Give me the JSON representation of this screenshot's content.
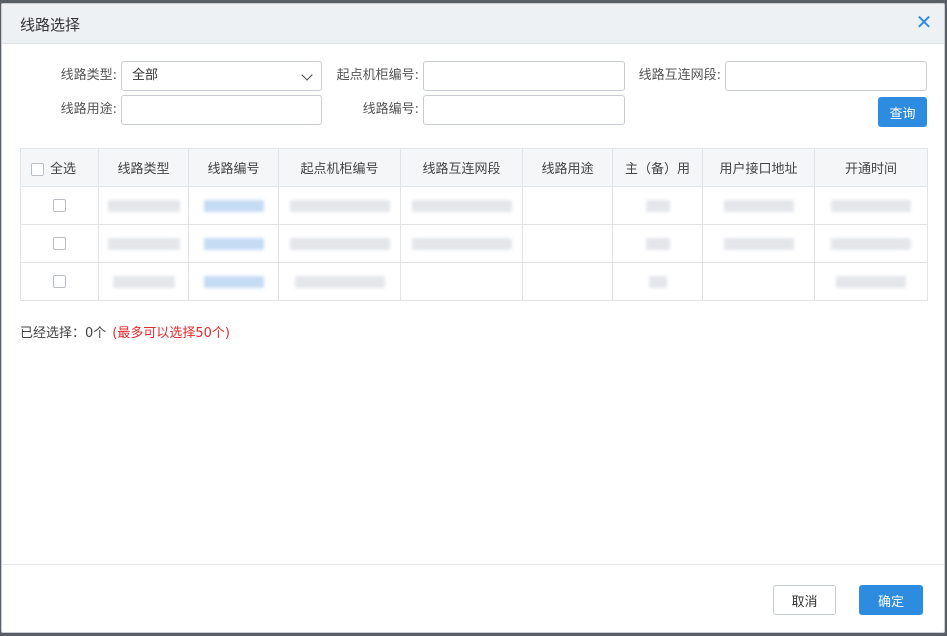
{
  "dialog": {
    "title": "线路选择",
    "close_glyph": "✕"
  },
  "form": {
    "line_type_label": "线路类型:",
    "line_type_value": "全部",
    "start_cabinet_label": "起点机柜编号:",
    "start_cabinet_value": "",
    "interconnect_label": "线路互连网段:",
    "interconnect_value": "",
    "line_usage_label": "线路用途:",
    "line_usage_value": "",
    "line_no_label": "线路编号:",
    "line_no_value": "",
    "query_button": "查询"
  },
  "table": {
    "select_all": "全选",
    "columns": [
      "线路类型",
      "线路编号",
      "起点机柜编号",
      "线路互连网段",
      "线路用途",
      "主（备）用",
      "用户接口地址",
      "开通时间"
    ],
    "rows": [
      {
        "cells": [
          "",
          "",
          "",
          "",
          "",
          "",
          "",
          ""
        ]
      },
      {
        "cells": [
          "",
          "",
          "",
          "",
          "",
          "",
          "",
          ""
        ]
      },
      {
        "cells": [
          "",
          "",
          "",
          "",
          "",
          "",
          "",
          ""
        ]
      }
    ]
  },
  "selection": {
    "selected_text": "已经选择：0个",
    "limit_text": "(最多可以选择50个)"
  },
  "footer": {
    "cancel_button": "取消",
    "confirm_button": "确定"
  },
  "colors": {
    "primary": "#2d8ce0",
    "warning": "#e5282c",
    "header_bg": "#eef1f4"
  },
  "icons": {
    "close": "close-icon",
    "dropdown": "chevron-down-icon"
  }
}
